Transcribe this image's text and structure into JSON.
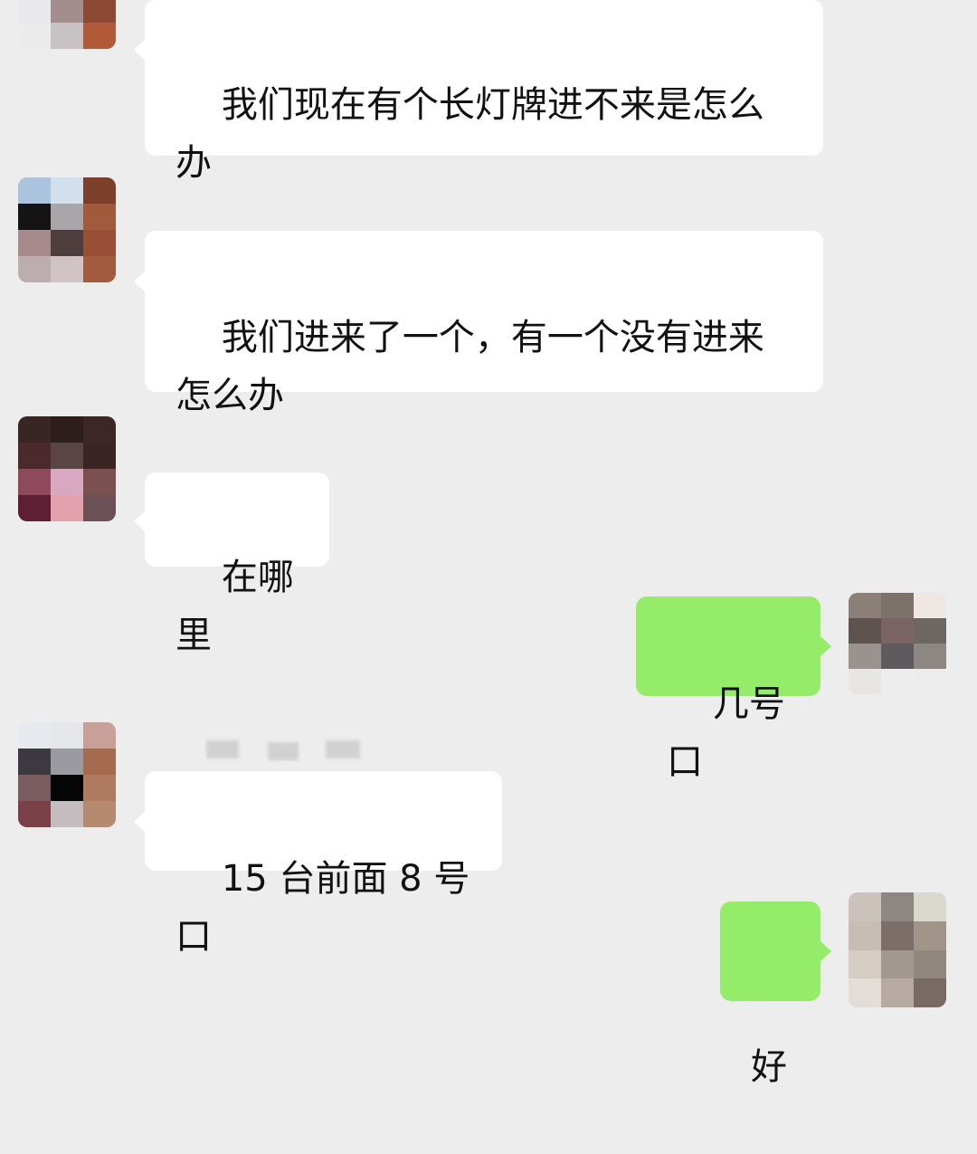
{
  "messages": [
    {
      "side": "incoming",
      "text": "我们现在有个长灯牌进不来是怎么\n办"
    },
    {
      "side": "incoming",
      "text": "我们进来了一个，有一个没有进来\n怎么办"
    },
    {
      "side": "incoming",
      "text": "在哪里"
    },
    {
      "side": "outgoing",
      "text": "几号口"
    },
    {
      "side": "incoming",
      "text": "15 台前面 8 号口"
    },
    {
      "side": "outgoing",
      "text": "好"
    }
  ],
  "colors": {
    "background": "#ededed",
    "incoming_bubble": "#ffffff",
    "outgoing_bubble": "#95ec69"
  }
}
